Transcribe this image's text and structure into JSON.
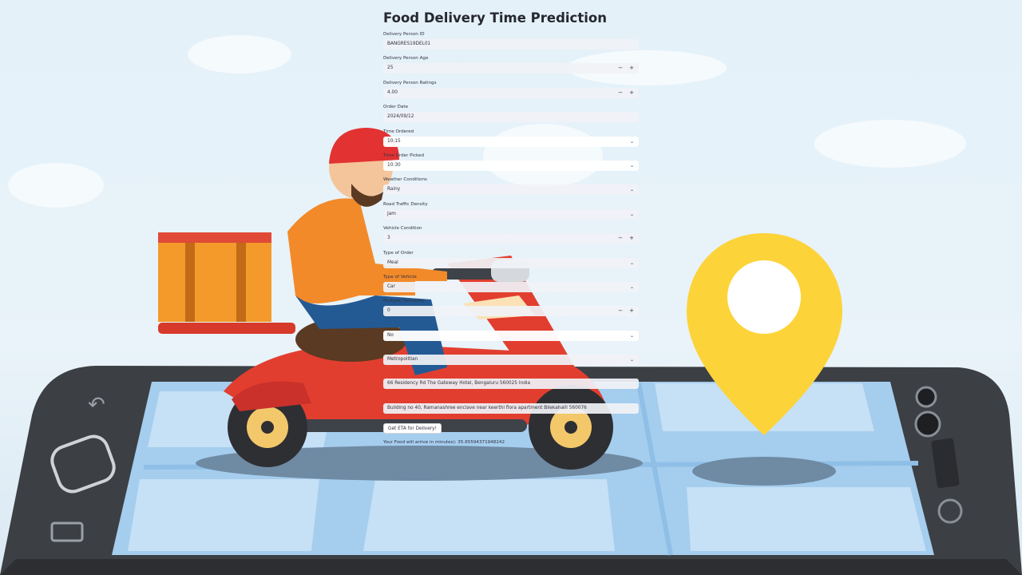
{
  "app": {
    "title": "Food Delivery Time Prediction"
  },
  "fields": [
    {
      "label": "Delivery Person ID",
      "value": "BANGRES19DEL01",
      "kind": "text"
    },
    {
      "label": "Delivery Person Age",
      "value": "25",
      "kind": "number"
    },
    {
      "label": "Delivery Person Ratings",
      "value": "4.00",
      "kind": "number"
    },
    {
      "label": "Order Date",
      "value": "2024/09/12",
      "kind": "date"
    },
    {
      "label": "Time Ordered",
      "value": "10:15",
      "kind": "select"
    },
    {
      "label": "Time Order Picked",
      "value": "10:30",
      "kind": "select"
    },
    {
      "label": "Weather Conditions",
      "value": "Rainy",
      "kind": "select"
    },
    {
      "label": "Road Traffic Density",
      "value": "Jam",
      "kind": "select"
    },
    {
      "label": "Vehicle Condition",
      "value": "3",
      "kind": "number"
    },
    {
      "label": "Type of Order",
      "value": "Meal",
      "kind": "select"
    },
    {
      "label": "Type of Vehicle",
      "value": "Car",
      "kind": "select"
    },
    {
      "label": "Multiple Deliveries",
      "value": "0",
      "kind": "number"
    },
    {
      "label": "",
      "value": "No",
      "kind": "select"
    },
    {
      "label": "",
      "value": "Metropolitian",
      "kind": "select"
    },
    {
      "label": "",
      "value": "66 Residency Rd The Gateway Hotel, Bengaluru 560025 India",
      "kind": "text"
    },
    {
      "label": "",
      "value": "Building no 40, Ramanashree enclave near keerthi flora apartment Bilekahalli 560076",
      "kind": "text"
    }
  ],
  "controls": {
    "minus": "−",
    "plus": "+",
    "chevron": "⌄"
  },
  "button": {
    "label": "Get ETA for Delivery!"
  },
  "result": {
    "text": "Your Food will arrive in minutes): 35.65594371948242"
  },
  "colors": {
    "accent": "#ff4b4b",
    "text": "#31333f",
    "input_bg": "#f0f2f6"
  }
}
